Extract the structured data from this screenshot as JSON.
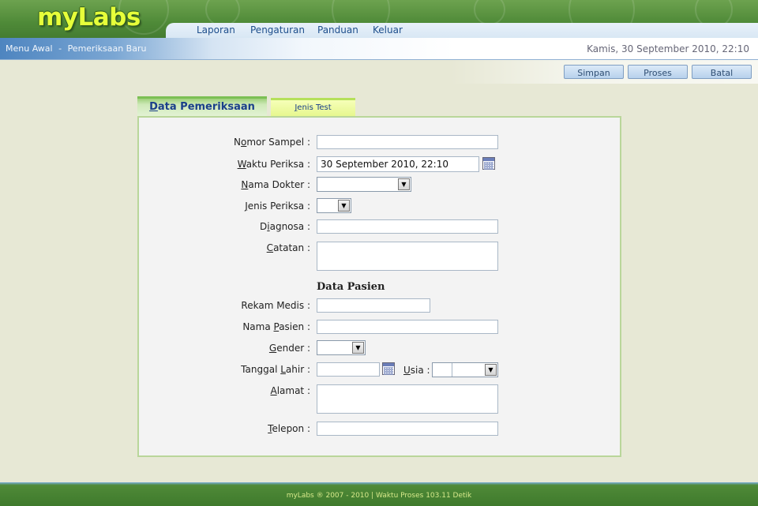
{
  "header": {
    "logo": "myLabs",
    "nav": [
      "Laporan",
      "Pengaturan",
      "Panduan",
      "Keluar"
    ]
  },
  "breadcrumb": {
    "home": "Menu Awal",
    "separator": "-",
    "current": "Pemeriksaan Baru"
  },
  "datetime": "Kamis, 30 September 2010, 22:10",
  "toolbar": {
    "save_label": "Simpan",
    "process_label": "Proses",
    "cancel_label": "Batal"
  },
  "tabs": {
    "active": {
      "first": "D",
      "rest": "ata Pemeriksaan"
    },
    "inactive": {
      "first": "J",
      "rest": "enis Test"
    }
  },
  "form": {
    "nomor_sampel": {
      "pre": "N",
      "acc": "o",
      "post": "mor Sampel :",
      "value": ""
    },
    "waktu_periksa": {
      "pre": "",
      "acc": "W",
      "post": "aktu Periksa :",
      "value": "30 September 2010, 22:10"
    },
    "nama_dokter": {
      "pre": "",
      "acc": "N",
      "post": "ama Dokter :",
      "value": ""
    },
    "jenis_periksa": {
      "pre": "",
      "acc": "J",
      "post": "enis Periksa :",
      "value": ""
    },
    "diagnosa": {
      "pre": "D",
      "acc": "i",
      "post": "agnosa :",
      "value": ""
    },
    "catatan": {
      "pre": "",
      "acc": "C",
      "post": "atatan :",
      "value": ""
    }
  },
  "pasien": {
    "title": "Data Pasien",
    "rekam_medis": {
      "label": "Rekam Medis :",
      "value": ""
    },
    "nama_pasien": {
      "pre": "Nama ",
      "acc": "P",
      "post": "asien :",
      "value": ""
    },
    "gender": {
      "pre": "",
      "acc": "G",
      "post": "ender :",
      "value": ""
    },
    "tanggal_lahir": {
      "pre": "Tanggal ",
      "acc": "L",
      "post": "ahir :",
      "value": ""
    },
    "usia": {
      "pre": "",
      "acc": "U",
      "post": "sia :",
      "value": ""
    },
    "alamat": {
      "pre": "",
      "acc": "A",
      "post": "lamat :",
      "value": ""
    },
    "telepon": {
      "pre": "",
      "acc": "T",
      "post": "elepon :",
      "value": ""
    }
  },
  "footer": {
    "text": "myLabs ® 2007 - 2010  |  Waktu Proses 103.11 Detik"
  },
  "colors": {
    "header_green": "#4f8a38",
    "logo_yellow": "#e6ff3a",
    "nav_text": "#1d4e8c",
    "page_bg": "#e7e8d5"
  }
}
